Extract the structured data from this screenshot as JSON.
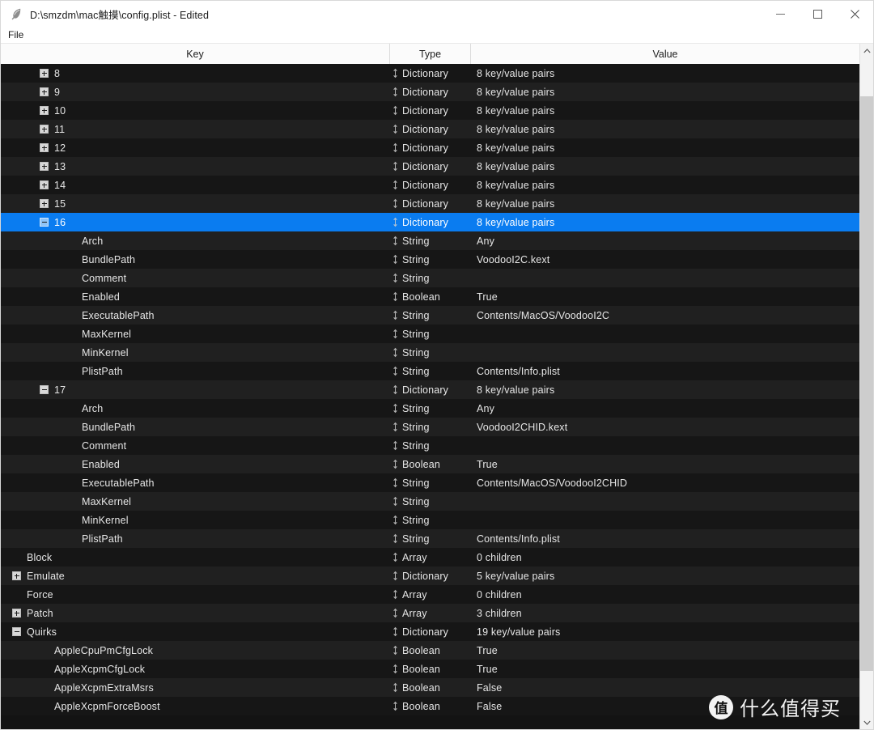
{
  "window": {
    "title": "D:\\smzdm\\mac触摸\\config.plist - Edited",
    "app_icon": "feather-icon",
    "controls": {
      "minimize": "Minimize",
      "maximize": "Maximize",
      "close": "Close"
    }
  },
  "menubar": {
    "items": [
      {
        "label": "File"
      }
    ]
  },
  "table": {
    "columns": [
      {
        "label": "Key"
      },
      {
        "label": "Type"
      },
      {
        "label": "Value"
      }
    ],
    "selected_index": 8,
    "rows": [
      {
        "indent": 2,
        "expander": "plus",
        "key": "8",
        "type": "Dictionary",
        "value": "8 key/value pairs"
      },
      {
        "indent": 2,
        "expander": "plus",
        "key": "9",
        "type": "Dictionary",
        "value": "8 key/value pairs"
      },
      {
        "indent": 2,
        "expander": "plus",
        "key": "10",
        "type": "Dictionary",
        "value": "8 key/value pairs"
      },
      {
        "indent": 2,
        "expander": "plus",
        "key": "11",
        "type": "Dictionary",
        "value": "8 key/value pairs"
      },
      {
        "indent": 2,
        "expander": "plus",
        "key": "12",
        "type": "Dictionary",
        "value": "8 key/value pairs"
      },
      {
        "indent": 2,
        "expander": "plus",
        "key": "13",
        "type": "Dictionary",
        "value": "8 key/value pairs"
      },
      {
        "indent": 2,
        "expander": "plus",
        "key": "14",
        "type": "Dictionary",
        "value": "8 key/value pairs"
      },
      {
        "indent": 2,
        "expander": "plus",
        "key": "15",
        "type": "Dictionary",
        "value": "8 key/value pairs"
      },
      {
        "indent": 2,
        "expander": "minus",
        "key": "16",
        "type": "Dictionary",
        "value": "8 key/value pairs"
      },
      {
        "indent": 3,
        "expander": "none",
        "key": "Arch",
        "type": "String",
        "value": "Any"
      },
      {
        "indent": 3,
        "expander": "none",
        "key": "BundlePath",
        "type": "String",
        "value": "VoodooI2C.kext"
      },
      {
        "indent": 3,
        "expander": "none",
        "key": "Comment",
        "type": "String",
        "value": ""
      },
      {
        "indent": 3,
        "expander": "none",
        "key": "Enabled",
        "type": "Boolean",
        "value": "True"
      },
      {
        "indent": 3,
        "expander": "none",
        "key": "ExecutablePath",
        "type": "String",
        "value": "Contents/MacOS/VoodooI2C"
      },
      {
        "indent": 3,
        "expander": "none",
        "key": "MaxKernel",
        "type": "String",
        "value": ""
      },
      {
        "indent": 3,
        "expander": "none",
        "key": "MinKernel",
        "type": "String",
        "value": ""
      },
      {
        "indent": 3,
        "expander": "none",
        "key": "PlistPath",
        "type": "String",
        "value": "Contents/Info.plist"
      },
      {
        "indent": 2,
        "expander": "minus",
        "key": "17",
        "type": "Dictionary",
        "value": "8 key/value pairs"
      },
      {
        "indent": 3,
        "expander": "none",
        "key": "Arch",
        "type": "String",
        "value": "Any"
      },
      {
        "indent": 3,
        "expander": "none",
        "key": "BundlePath",
        "type": "String",
        "value": "VoodooI2CHID.kext"
      },
      {
        "indent": 3,
        "expander": "none",
        "key": "Comment",
        "type": "String",
        "value": ""
      },
      {
        "indent": 3,
        "expander": "none",
        "key": "Enabled",
        "type": "Boolean",
        "value": "True"
      },
      {
        "indent": 3,
        "expander": "none",
        "key": "ExecutablePath",
        "type": "String",
        "value": "Contents/MacOS/VoodooI2CHID"
      },
      {
        "indent": 3,
        "expander": "none",
        "key": "MaxKernel",
        "type": "String",
        "value": ""
      },
      {
        "indent": 3,
        "expander": "none",
        "key": "MinKernel",
        "type": "String",
        "value": ""
      },
      {
        "indent": 3,
        "expander": "none",
        "key": "PlistPath",
        "type": "String",
        "value": "Contents/Info.plist"
      },
      {
        "indent": 1,
        "expander": "none",
        "key": "Block",
        "type": "Array",
        "value": "0 children"
      },
      {
        "indent": 1,
        "expander": "plus",
        "key": "Emulate",
        "type": "Dictionary",
        "value": "5 key/value pairs"
      },
      {
        "indent": 1,
        "expander": "none",
        "key": "Force",
        "type": "Array",
        "value": "0 children"
      },
      {
        "indent": 1,
        "expander": "plus",
        "key": "Patch",
        "type": "Array",
        "value": "3 children"
      },
      {
        "indent": 1,
        "expander": "minus",
        "key": "Quirks",
        "type": "Dictionary",
        "value": "19 key/value pairs"
      },
      {
        "indent": 2,
        "expander": "none",
        "key": "AppleCpuPmCfgLock",
        "type": "Boolean",
        "value": "True"
      },
      {
        "indent": 2,
        "expander": "none",
        "key": "AppleXcpmCfgLock",
        "type": "Boolean",
        "value": "True"
      },
      {
        "indent": 2,
        "expander": "none",
        "key": "AppleXcpmExtraMsrs",
        "type": "Boolean",
        "value": "False"
      },
      {
        "indent": 2,
        "expander": "none",
        "key": "AppleXcpmForceBoost",
        "type": "Boolean",
        "value": "False"
      }
    ]
  },
  "scrollbar": {
    "up_arrow": "chevron-up-icon",
    "down_arrow": "chevron-down-icon"
  },
  "watermark": {
    "logo_glyph": "值",
    "text": "什么值得买"
  },
  "colors": {
    "selection": "#0a7cf0",
    "row_odd": "#161616",
    "row_even": "#202020",
    "text": "#e6e6e6",
    "header_bg": "#fbfbfb"
  }
}
